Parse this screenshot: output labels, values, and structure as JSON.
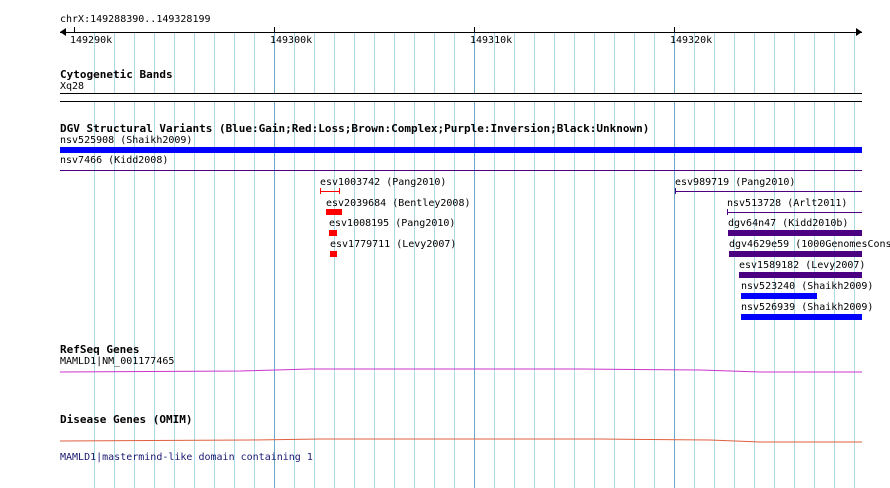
{
  "ruler": {
    "coords": "chrX:149288390..149328199",
    "ticks": [
      "149290k",
      "149300k",
      "149310k",
      "149320k"
    ]
  },
  "tracks": {
    "cyto": {
      "title": "Cytogenetic Bands",
      "band": "Xq28"
    },
    "dgv": {
      "title": "DGV Structural Variants (Blue:Gain;Red:Loss;Brown:Complex;Purple:Inversion;Black:Unknown)",
      "features": {
        "nsv525908": "nsv525908 (Shaikh2009)",
        "nsv7466": "nsv7466 (Kidd2008)",
        "esv1003742": "esv1003742 (Pang2010)",
        "esv2039684": "esv2039684 (Bentley2008)",
        "esv1008195": "esv1008195 (Pang2010)",
        "esv1779711": "esv1779711 (Levy2007)",
        "esv989719": "esv989719 (Pang2010)",
        "nsv513728": "nsv513728 (Arlt2011)",
        "dgv64n47": "dgv64n47 (Kidd2010b)",
        "dgv4629e59": "dgv4629e59 (1000GenomesCons",
        "esv1589182": "esv1589182 (Levy2007)",
        "nsv523240": "nsv523240 (Shaikh2009)",
        "nsv526939": "nsv526939 (Shaikh2009)"
      }
    },
    "refseq": {
      "title": "RefSeq Genes",
      "gene": "MAMLD1|NM_001177465"
    },
    "omim": {
      "title": "Disease Genes (OMIM)",
      "gene": "MAMLD1|mastermind-like domain containing 1"
    }
  },
  "colors": {
    "grid": "#add8e6",
    "gain": "#0000ff",
    "loss": "#ff0000",
    "inversion": "#4b0082",
    "nav": "#191970",
    "refseq": "#cc33cc",
    "omim": "#e06040"
  }
}
